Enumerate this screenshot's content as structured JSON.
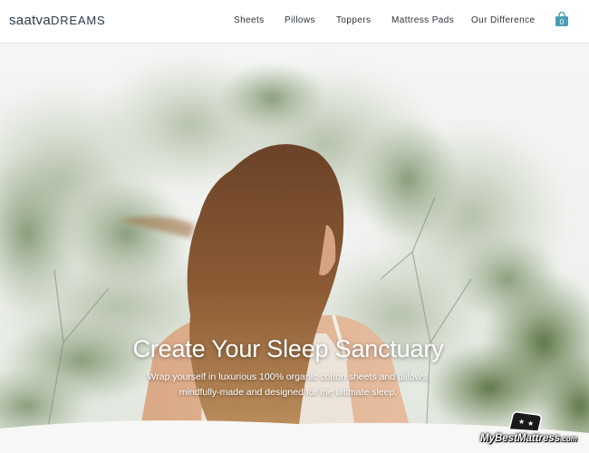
{
  "header": {
    "logo_brand": "saatva",
    "logo_dreams": "DREAMS",
    "nav": [
      "Sheets",
      "Pillows",
      "Toppers",
      "Mattress Pads",
      "Our Difference"
    ],
    "cart_count": "0"
  },
  "hero": {
    "headline": "Create Your Sleep Sanctuary",
    "subtext_line1": "Wrap yourself in luxurious 100% organic cotton sheets and pillows,",
    "subtext_line2": "mindfully-made and designed for the ultimate sleep."
  },
  "watermark": {
    "text": "MyBestMattress",
    "suffix": ".com"
  },
  "colors": {
    "logo": "#2b3a4a",
    "cart": "#4a9fb0",
    "nav_text": "#2c3138"
  },
  "icons": {
    "cart": "shopping-bag-icon",
    "watermark": "mattress-stars-icon"
  }
}
